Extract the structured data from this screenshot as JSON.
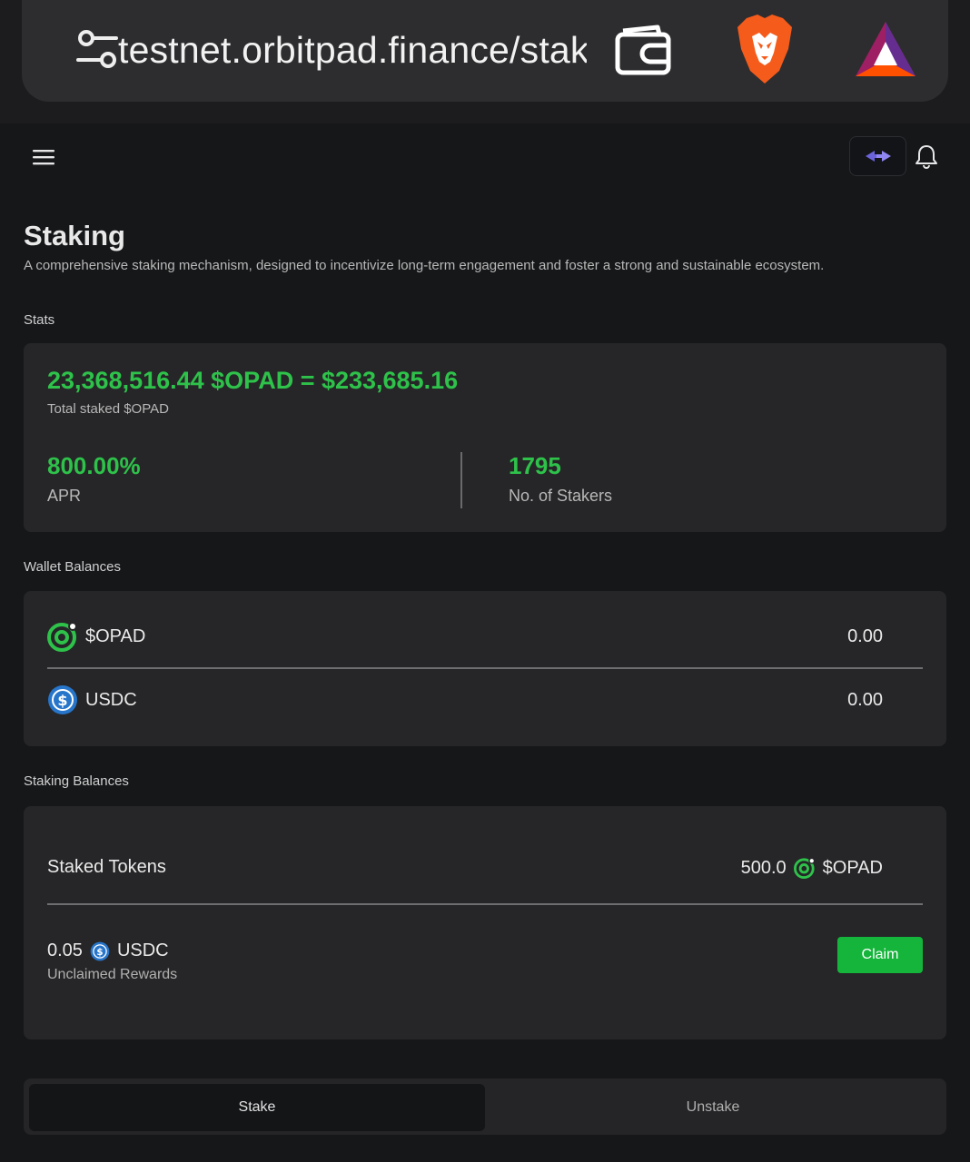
{
  "browser": {
    "url": "testnet.orbitpad.finance/stak",
    "icons": [
      "site-settings-icon",
      "wallet-icon",
      "brave-icon",
      "bat-icon"
    ]
  },
  "header": {
    "icons": [
      "hamburger-menu-icon",
      "network-switch-icon",
      "bell-icon"
    ]
  },
  "page": {
    "title": "Staking",
    "subtitle": "A comprehensive staking mechanism, designed to incentivize long-term engagement and foster a strong and sustainable ecosystem."
  },
  "stats": {
    "label": "Stats",
    "total": "23,368,516.44 $OPAD = $233,685.16",
    "total_caption": "Total staked $OPAD",
    "apr_value": "800.00%",
    "apr_caption": "APR",
    "stakers_value": "1795",
    "stakers_caption": "No. of Stakers"
  },
  "wallet": {
    "label": "Wallet Balances",
    "tokens": [
      {
        "name": "$OPAD",
        "amount": "0.00",
        "icon": "opad-token-icon"
      },
      {
        "name": "USDC",
        "amount": "0.00",
        "icon": "usdc-token-icon"
      }
    ]
  },
  "staking": {
    "label": "Staking Balances",
    "staked_label": "Staked Tokens",
    "staked_amount": "500.0",
    "staked_token": "$OPAD",
    "reward_amount": "0.05",
    "reward_token": "USDC",
    "reward_caption": "Unclaimed Rewards",
    "claim_label": "Claim"
  },
  "tabs": {
    "stake": "Stake",
    "unstake": "Unstake",
    "active": "Stake"
  },
  "colors": {
    "accent_green": "#2ec24a",
    "button_green": "#14b53a",
    "background": "#161719",
    "card": "#262628",
    "usdc_blue": "#2775ca"
  }
}
